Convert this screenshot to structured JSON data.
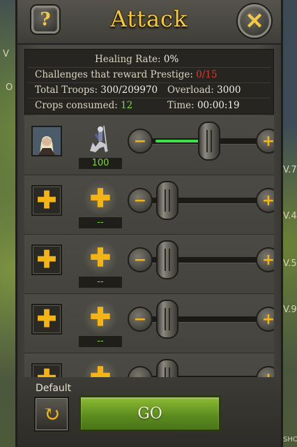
{
  "header": {
    "title": "Attack",
    "help_icon": "?",
    "close_icon": "✕"
  },
  "info": {
    "healing_rate_label": "Healing Rate:",
    "healing_rate_value": "0%",
    "prestige_label": "Challenges that reward Prestige:",
    "prestige_value": "0/15",
    "total_troops_label": "Total Troops:",
    "total_troops_value": "300/209970",
    "overload_label": "Overload:",
    "overload_value": "3000",
    "crops_label": "Crops consumed:",
    "crops_value": "12",
    "time_label": "Time:",
    "time_value": "00:00:19"
  },
  "rows": [
    {
      "hero": true,
      "count": "100",
      "slider_fraction": 0.55
    },
    {
      "hero": false,
      "count": "--",
      "slider_fraction": 0.12
    },
    {
      "hero": false,
      "count": "--",
      "slider_fraction": 0.12
    },
    {
      "hero": false,
      "count": "--",
      "slider_fraction": 0.12
    },
    {
      "hero": false,
      "count": "--",
      "slider_fraction": 0.12
    }
  ],
  "footer": {
    "default_label": "Default",
    "go_label": "GO"
  },
  "side_labels": {
    "left": [
      "V",
      "O"
    ],
    "right": [
      "V.7",
      "V.4",
      "V.5",
      "V.9",
      "SHO"
    ]
  },
  "colors": {
    "title": "#f2c84a",
    "accent": "#f2b416",
    "green": "#7fd640",
    "red": "#e23a2a",
    "go": "#6fa12a"
  }
}
